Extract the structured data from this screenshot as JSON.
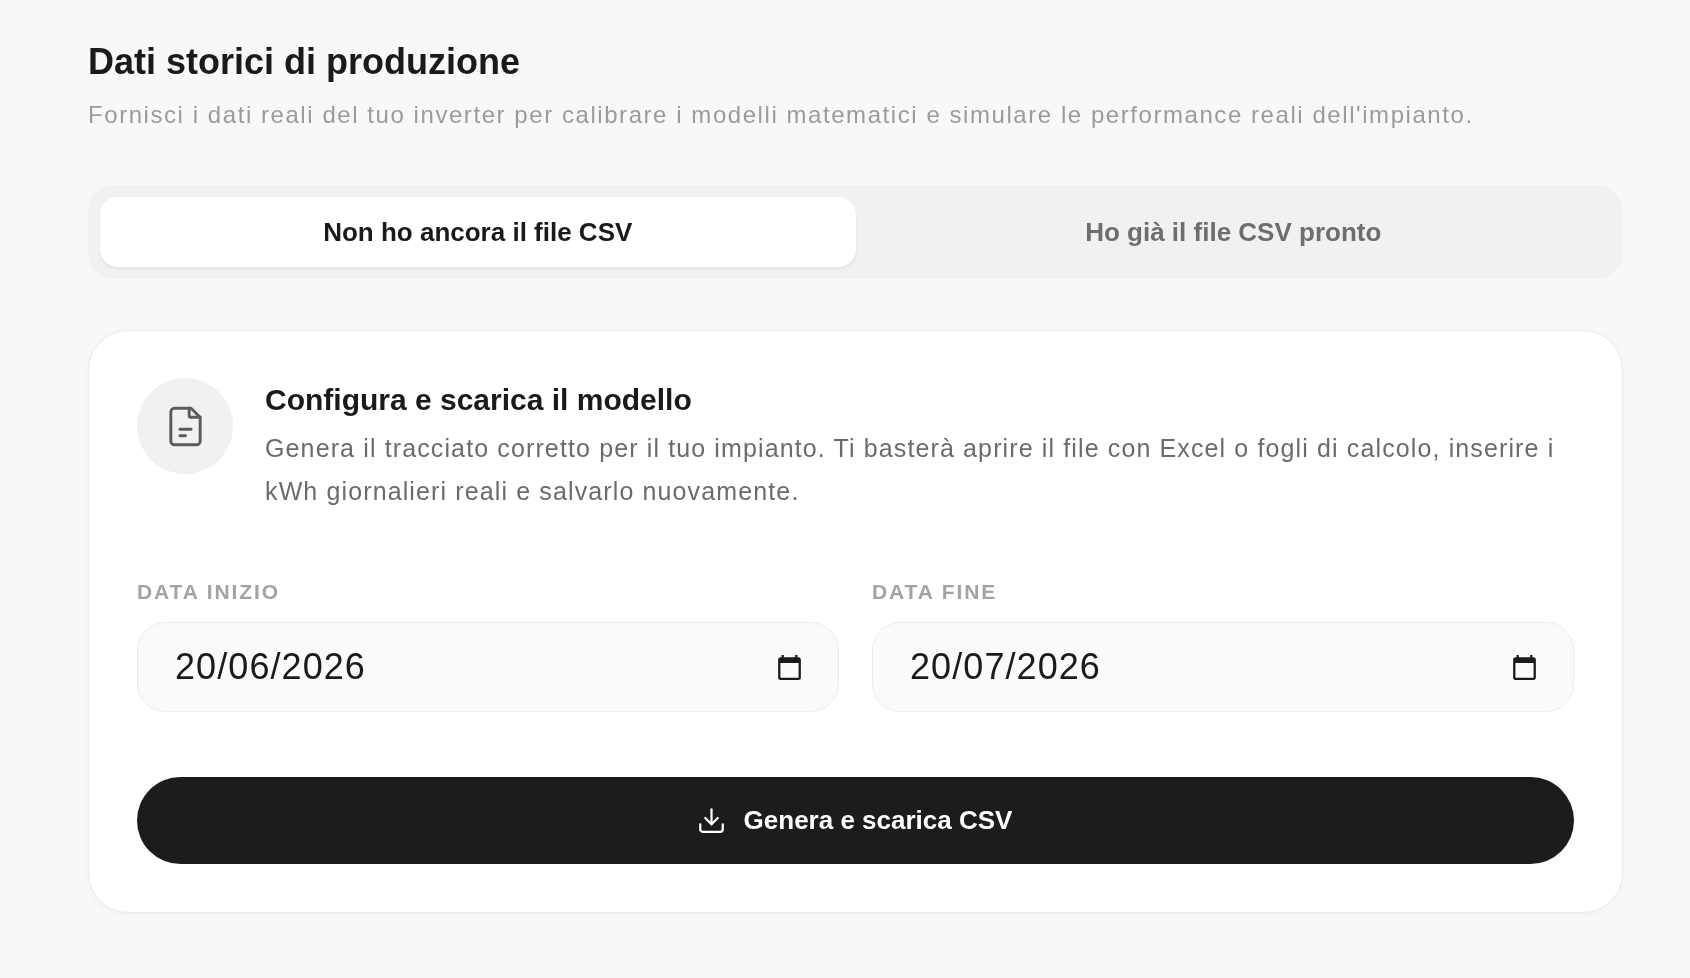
{
  "header": {
    "title": "Dati storici di produzione",
    "subtitle": "Fornisci i dati reali del tuo inverter per calibrare i modelli matematici e simulare le performance reali dell'impianto."
  },
  "tabs": [
    {
      "label": "Non ho ancora il file CSV",
      "selected": true
    },
    {
      "label": "Ho già il file CSV pronto",
      "selected": false
    }
  ],
  "card": {
    "title": "Configura e scarica il modello",
    "description": "Genera il tracciato corretto per il tuo impianto. Ti basterà aprire il file con Excel o fogli di calcolo, inserire i kWh giornalieri reali e salvarlo nuovamente.",
    "fields": [
      {
        "label": "DATA INIZIO",
        "value": "20/06/2026"
      },
      {
        "label": "DATA FINE",
        "value": "20/07/2026"
      }
    ],
    "button": {
      "label": "Genera e scarica CSV"
    }
  }
}
